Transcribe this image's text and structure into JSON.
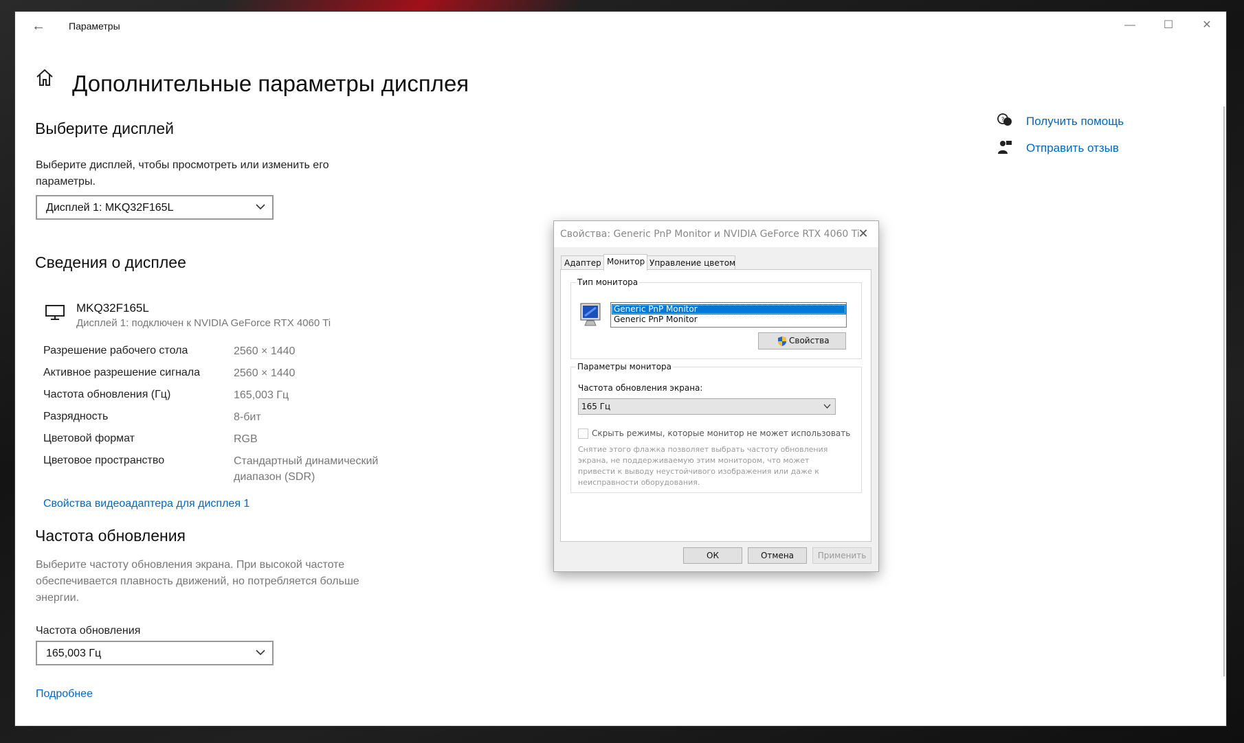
{
  "window": {
    "app_title": "Параметры",
    "page_title": "Дополнительные параметры дисплея"
  },
  "choose_display": {
    "heading": "Выберите дисплей",
    "description": "Выберите дисплей, чтобы просмотреть или изменить его параметры.",
    "selected": "Дисплей 1: MKQ32F165L"
  },
  "display_info": {
    "heading": "Сведения о дисплее",
    "monitor_name": "MKQ32F165L",
    "monitor_sub": "Дисплей 1: подключен к NVIDIA GeForce RTX 4060 Ti",
    "rows": [
      {
        "label": "Разрешение рабочего стола",
        "value": "2560 × 1440"
      },
      {
        "label": "Активное разрешение сигнала",
        "value": "2560 × 1440"
      },
      {
        "label": "Частота обновления (Гц)",
        "value": "165,003 Гц"
      },
      {
        "label": "Разрядность",
        "value": "8-бит"
      },
      {
        "label": "Цветовой формат",
        "value": "RGB"
      },
      {
        "label": "Цветовое пространство",
        "value": "Стандартный динамический диапазон (SDR)"
      }
    ],
    "adapter_link": "Свойства видеоадаптера для дисплея 1"
  },
  "refresh": {
    "heading": "Частота обновления",
    "description": "Выберите частоту обновления экрана. При высокой частоте обеспечивается плавность движений, но потребляется больше энергии.",
    "field_label": "Частота обновления",
    "selected": "165,003 Гц",
    "more_link": "Подробнее"
  },
  "side_links": {
    "help": "Получить помощь",
    "feedback": "Отправить отзыв"
  },
  "dialog": {
    "title": "Свойства: Generic PnP Monitor и NVIDIA GeForce RTX 4060 Ti",
    "tabs": [
      "Адаптер",
      "Монитор",
      "Управление цветом"
    ],
    "active_tab": "Монитор",
    "monitor_type": {
      "legend": "Тип монитора",
      "items": [
        "Generic PnP Monitor",
        "Generic PnP Monitor"
      ],
      "properties_button": "Свойства"
    },
    "monitor_settings": {
      "legend": "Параметры монитора",
      "rate_label": "Частота обновления экрана:",
      "rate_value": "165 Гц",
      "hide_modes_label": "Скрыть режимы, которые монитор не может использовать",
      "hide_modes_checked": false,
      "note": "Снятие этого флажка позволяет выбрать частоту обновления экрана, не поддерживаемую этим монитором, что может привести к выводу неустойчивого изображения или даже к неисправности оборудования."
    },
    "buttons": {
      "ok": "ОК",
      "cancel": "Отмена",
      "apply": "Применить"
    }
  }
}
